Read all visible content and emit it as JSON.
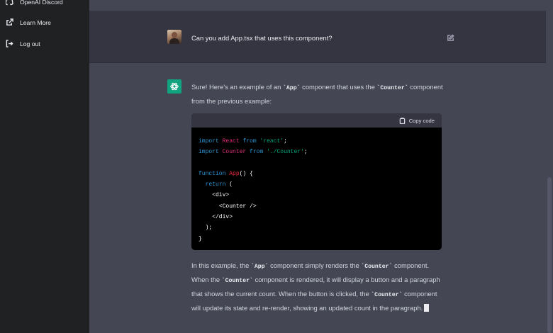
{
  "sidebar": {
    "items": [
      {
        "label": "OpenAI Discord",
        "icon": "discord-icon"
      },
      {
        "label": "Learn More",
        "icon": "external-link-icon"
      },
      {
        "label": "Log out",
        "icon": "logout-icon"
      }
    ]
  },
  "conversation": {
    "user_message": "Can you add App.tsx that uses this component?",
    "assistant": {
      "intro": {
        "t1": "Sure! Here's an example of an ",
        "c1": "`App`",
        "t2": " component that uses the ",
        "c2": "`Counter`",
        "t3": " component from the previous example:"
      },
      "code_block": {
        "copy_label": "Copy code",
        "lines": [
          "import React from 'react';",
          "import Counter from './Counter';",
          "",
          "function App() {",
          "  return (",
          "    <div>",
          "      <Counter />",
          "    </div>",
          "  );",
          "}"
        ]
      },
      "explanation": {
        "t1": "In this example, the ",
        "c1": "`App`",
        "t2": " component simply renders the ",
        "c2": "`Counter`",
        "t3": " component. When the ",
        "c3": "`Counter`",
        "t4": " component is rendered, it will display a button and a paragraph that shows the current count. When the button is clicked, the ",
        "c4": "`Counter`",
        "t5": " component will update its state and re-render, showing an updated count in the paragraph."
      }
    }
  },
  "colors": {
    "sidebar_bg": "#202123",
    "user_row_bg": "#343541",
    "assistant_bg": "#444654",
    "bot_avatar": "#10a37f",
    "code_bg": "#000000"
  }
}
